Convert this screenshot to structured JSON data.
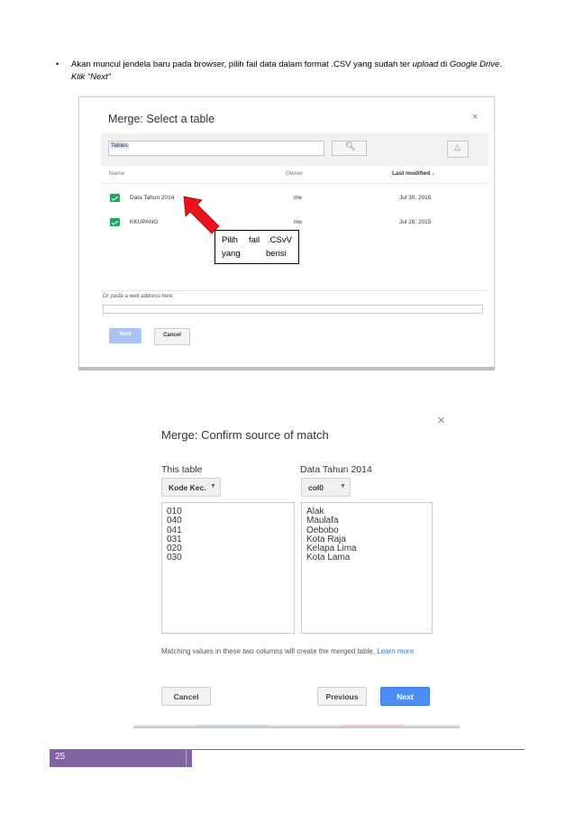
{
  "instruction": {
    "bullet": "•",
    "line1_a": "Akan muncul jendela baru pada browser, pilih fail data dalam format .CSV yang sudah ter ",
    "line1_upload": "upload",
    "line1_b": " di ",
    "line1_drive": "Google Drive",
    "line1_c": ".",
    "line2": "Klik “Next”"
  },
  "dialog1": {
    "title": "Merge: Select a table",
    "close": "×",
    "search_label": "Tables",
    "search_icon": "search-icon",
    "drive_icon": "drive-icon",
    "columns": {
      "name": "Name",
      "owner": "Owner",
      "modified": "Last modified ↓"
    },
    "rows": [
      {
        "name": "Data Tahun 2014",
        "owner": "me",
        "date": "Jul 30, 2015"
      },
      {
        "name": "KKUPANG",
        "owner": "me",
        "date": "Jul 28, 2015"
      }
    ],
    "paste_label": "Or paste a web address here:",
    "next": "Next",
    "cancel": "Cancel",
    "accent_color": "#1fa463"
  },
  "annotation": {
    "a": "Pilih",
    "b": "fail",
    "c": ".CSvV",
    "d": "yang",
    "e": "berisi",
    "arrow_color": "#e8141c"
  },
  "dialog2": {
    "title": "Merge: Confirm source of match",
    "close": "×",
    "this_table": "This table",
    "other_table": "Data Tahun 2014",
    "dd1": "Kode Kec.",
    "dd2": "col0",
    "list1": [
      "010",
      "040",
      "041",
      "031",
      "020",
      "030"
    ],
    "list2": [
      "Alak",
      "Maulafa",
      "Oebobo",
      "Kota Raja",
      "Kelapa Lima",
      "Kota Lama"
    ],
    "hint": "Matching values in these two columns will create the merged table.",
    "learn_more": "Learn more",
    "cancel": "Cancel",
    "previous": "Previous",
    "next": "Next",
    "primary_color": "#4d8ef5"
  },
  "footer": {
    "page_number": "25",
    "color": "#8064a2"
  }
}
